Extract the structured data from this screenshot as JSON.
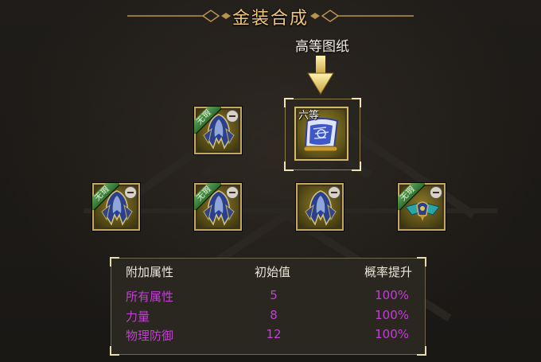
{
  "title": "金装合成",
  "subtitle": "高等图纸",
  "target": {
    "grade": "六等",
    "item": "blueprint-scroll-icon"
  },
  "materials": [
    {
      "badge": "无瑕",
      "item": "shoulder-armor-icon"
    },
    {
      "badge": "无瑕",
      "item": "shoulder-armor-icon"
    },
    {
      "badge": "无瑕",
      "item": "shoulder-armor-icon"
    },
    {
      "badge": "",
      "item": "shoulder-armor-icon"
    },
    {
      "badge": "无瑕",
      "item": "winged-helm-icon"
    }
  ],
  "stats": {
    "headers": [
      "附加属性",
      "初始值",
      "概率提升"
    ],
    "rows": [
      [
        "所有属性",
        "5",
        "100%"
      ],
      [
        "力量",
        "8",
        "100%"
      ],
      [
        "物理防御",
        "12",
        "100%"
      ]
    ]
  },
  "colors": {
    "title": "#f0c77a",
    "stat_text": "#c33fd6",
    "frame": "#c4a85c"
  }
}
